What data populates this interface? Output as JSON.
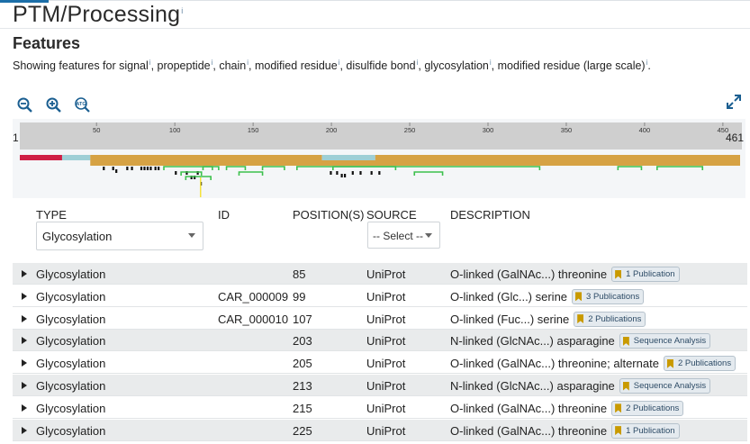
{
  "section": {
    "title": "PTM/Processing",
    "info": "i"
  },
  "features": {
    "title": "Features",
    "showing_prefix": "Showing features for ",
    "feature_types": [
      "signal",
      "propeptide",
      "chain",
      "modified residue",
      "disulfide bond",
      "glycosylation",
      "modified residue (large scale)"
    ],
    "info": "i"
  },
  "viewer": {
    "toolbar": [
      "zoom-out-icon",
      "zoom-in-icon",
      "sequence-atg-icon"
    ],
    "atg_label": "ATG",
    "expand_icon": "expand-arrows-icon",
    "ruler": {
      "start": "1",
      "end": "461",
      "ticks": [
        "50",
        "100",
        "150",
        "200",
        "250",
        "300",
        "350",
        "400",
        "450"
      ]
    },
    "colors": {
      "signal": "#cf1f45",
      "propeptide": "#9ecfd6",
      "chain": "#d6a244",
      "modified_residue": "#111111",
      "disulfide": "#3cc04c",
      "glycosylation_highlight": "#f5e23a",
      "ruler": "#cfcfcf"
    }
  },
  "table": {
    "headers": {
      "type": "TYPE",
      "id": "ID",
      "positions": "POSITION(S)",
      "source": "SOURCE",
      "description": "DESCRIPTION"
    },
    "type_filter": "Glycosylation",
    "source_filter": "-- Select --",
    "rows": [
      {
        "type": "Glycosylation",
        "id": "",
        "position": "85",
        "source": "UniProt",
        "description": "O-linked (GalNAc...) threonine",
        "evidence": "1 Publication"
      },
      {
        "type": "Glycosylation",
        "id": "CAR_000009",
        "position": "99",
        "source": "UniProt",
        "description": "O-linked (Glc...) serine",
        "evidence": "3 Publications"
      },
      {
        "type": "Glycosylation",
        "id": "CAR_000010",
        "position": "107",
        "source": "UniProt",
        "description": "O-linked (Fuc...) serine",
        "evidence": "2 Publications"
      },
      {
        "type": "Glycosylation",
        "id": "",
        "position": "203",
        "source": "UniProt",
        "description": "N-linked (GlcNAc...) asparagine",
        "evidence": "Sequence Analysis"
      },
      {
        "type": "Glycosylation",
        "id": "",
        "position": "205",
        "source": "UniProt",
        "description": "O-linked (GalNAc...) threonine; alternate",
        "evidence": "2 Publications"
      },
      {
        "type": "Glycosylation",
        "id": "",
        "position": "213",
        "source": "UniProt",
        "description": "N-linked (GlcNAc...) asparagine",
        "evidence": "Sequence Analysis"
      },
      {
        "type": "Glycosylation",
        "id": "",
        "position": "215",
        "source": "UniProt",
        "description": "O-linked (GalNAc...) threonine",
        "evidence": "2 Publications"
      },
      {
        "type": "Glycosylation",
        "id": "",
        "position": "225",
        "source": "UniProt",
        "description": "O-linked (GalNAc...) threonine",
        "evidence": "1 Publication"
      }
    ]
  }
}
